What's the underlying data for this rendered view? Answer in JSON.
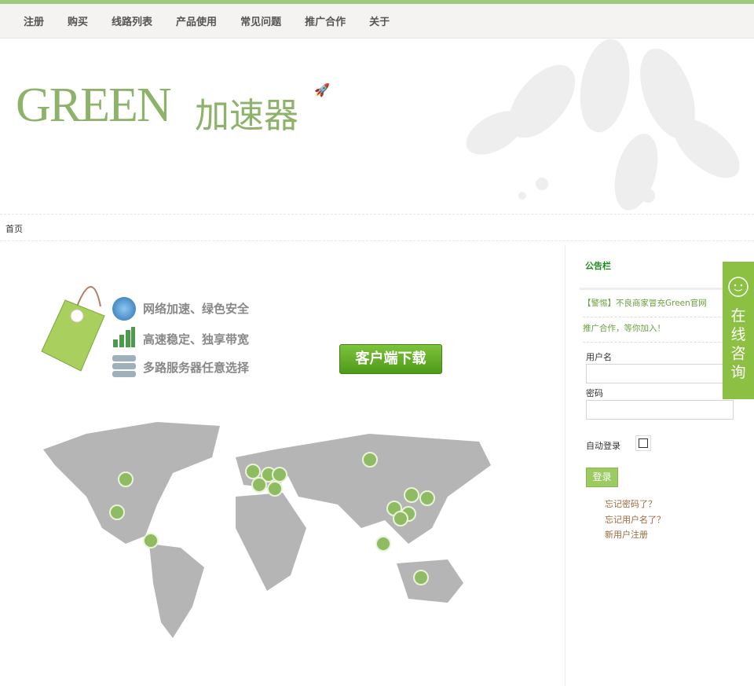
{
  "nav": [
    "注册",
    "购买",
    "线路列表",
    "产品使用",
    "常见问题",
    "推广合作",
    "关于"
  ],
  "header": {
    "logo_en": "GREEN",
    "logo_cn": "加速器"
  },
  "breadcrumb": "首页",
  "features": [
    "网络加速、绿色安全",
    "高速稳定、独享带宽",
    "多路服务器任意选择"
  ],
  "download_label": "客户端下载",
  "sidebar": {
    "notice_title": "公告栏",
    "notices": [
      "【警惕】不良商家冒充Green官网",
      "推广合作，等你加入！"
    ],
    "username_label": "用户名",
    "password_label": "密码",
    "remember_label": "自动登录",
    "login_label": "登录",
    "links": [
      "忘记密码了？",
      "忘记用户名了？",
      "新用户注册"
    ]
  },
  "chat": {
    "label": "在线咨询"
  },
  "colors": {
    "accent": "#8cc043",
    "logo": "#8db36a"
  }
}
